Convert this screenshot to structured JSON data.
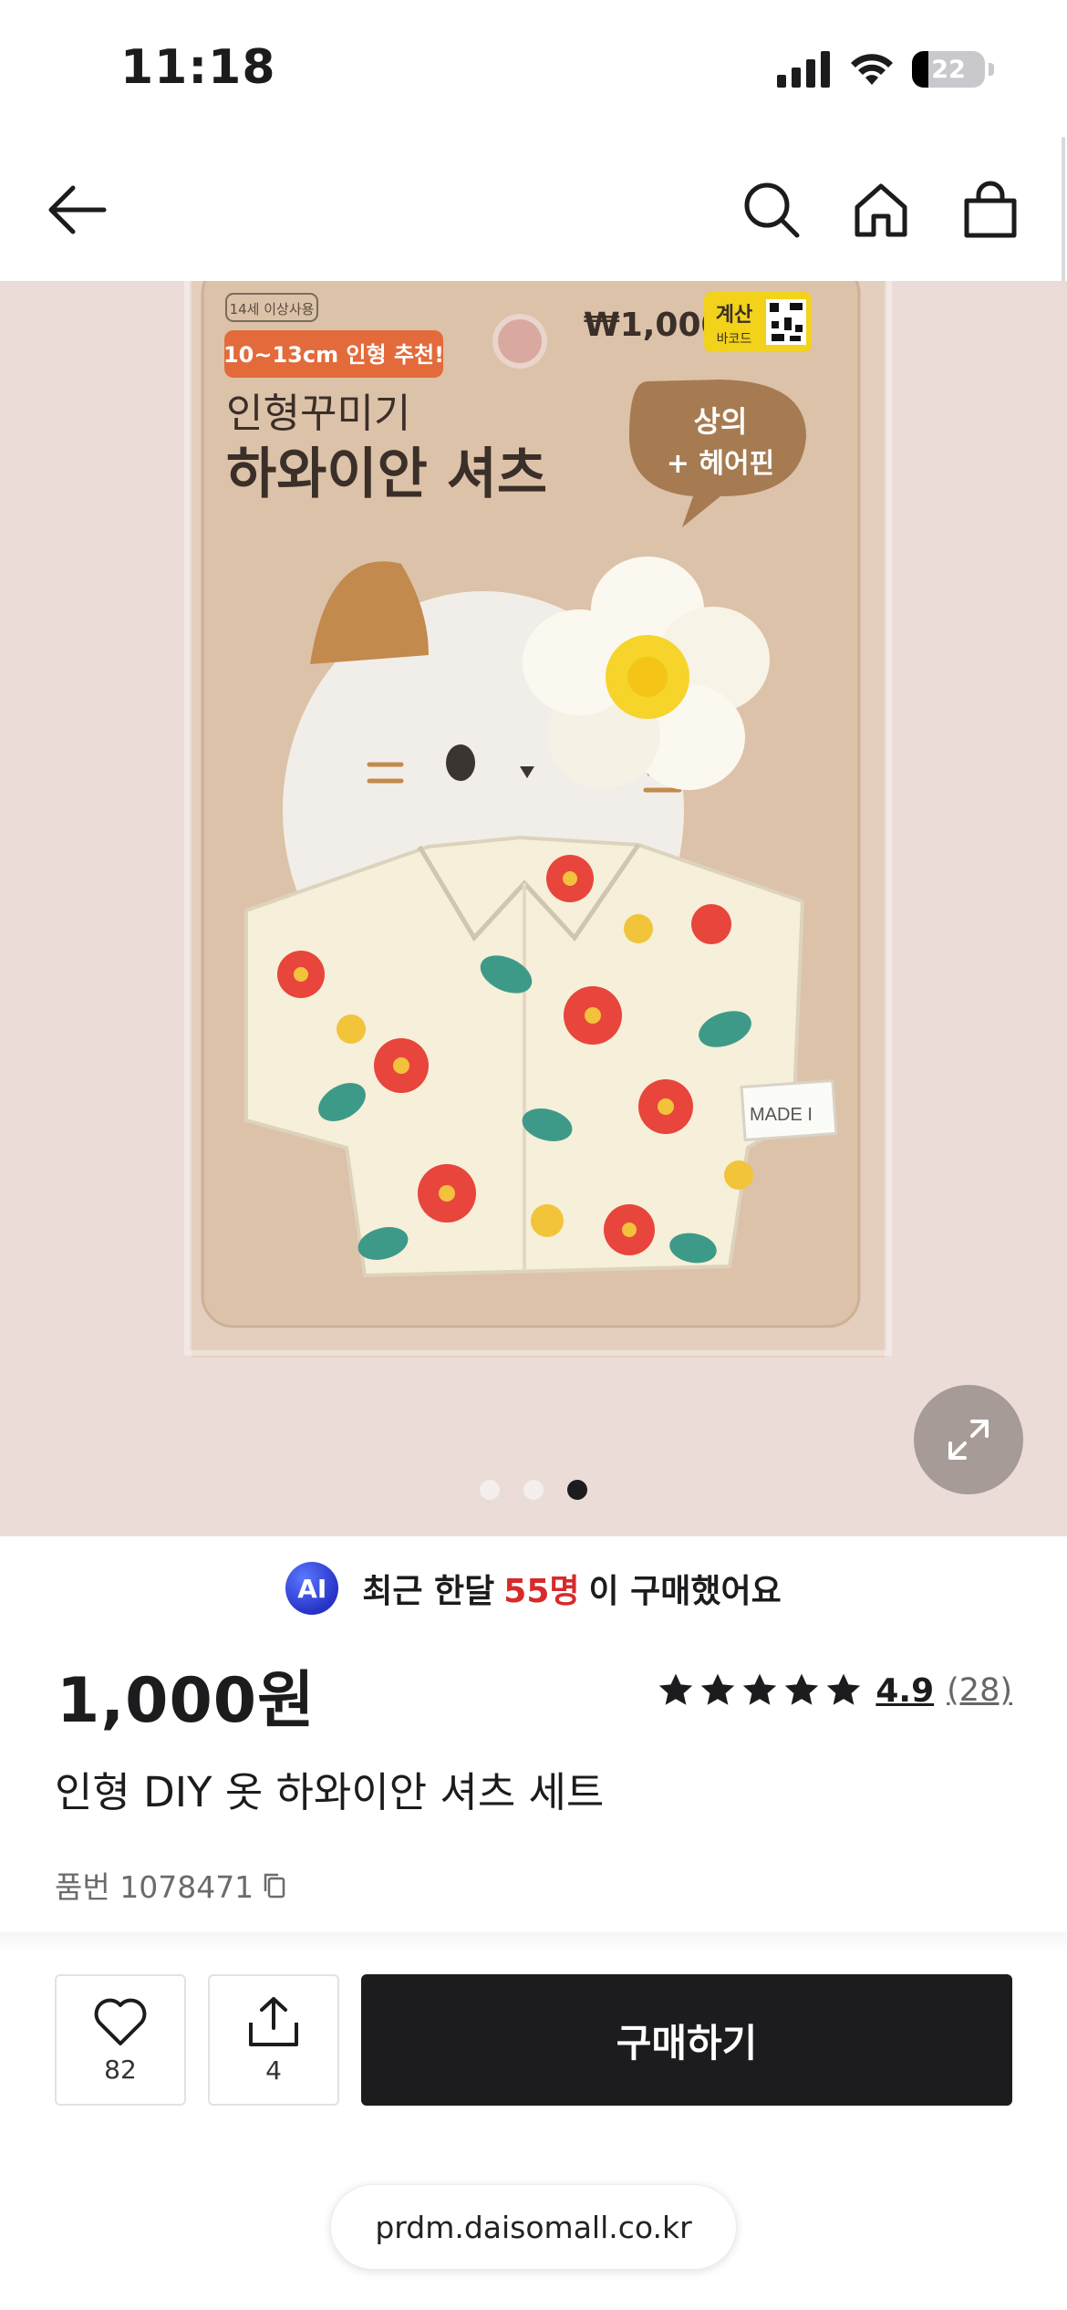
{
  "status_bar": {
    "time": "11:18",
    "battery": "22",
    "icons": [
      "signal-icon",
      "wifi-icon",
      "battery-icon"
    ]
  },
  "nav": {
    "icons": [
      "back-arrow-icon",
      "search-icon",
      "home-icon",
      "shopping-bag-icon"
    ]
  },
  "hero": {
    "package_age_label": "14세 이상사용",
    "package_size_label": "10~13cm 인형 추천!",
    "package_subtitle": "인형꾸미기",
    "package_title": "하와이안 셔츠",
    "package_price": "₩1,000",
    "package_barcode_label": "계산",
    "package_barcode_sub": "바코드",
    "package_bubble_line1": "상의",
    "package_bubble_line2": "+ 헤어핀",
    "tag_text": "MADE I",
    "carousel_count": 3,
    "carousel_active_index": 2
  },
  "ai_banner": {
    "badge": "AI",
    "prefix": "최근 한달",
    "count": "55명",
    "suffix": "이 구매했어요",
    "accent_color": "#d72a2a"
  },
  "product": {
    "price": "1,000원",
    "rating_score": "4.9",
    "rating_count": "(28)",
    "stars_filled": 5,
    "title": "인형 DIY 옷 하와이안 셔츠 세트",
    "sku": "품번 1078471"
  },
  "actions": {
    "like_count": "82",
    "share_count": "4",
    "buy_label": "구매하기"
  },
  "browser": {
    "url": "prdm.daisomall.co.kr"
  }
}
